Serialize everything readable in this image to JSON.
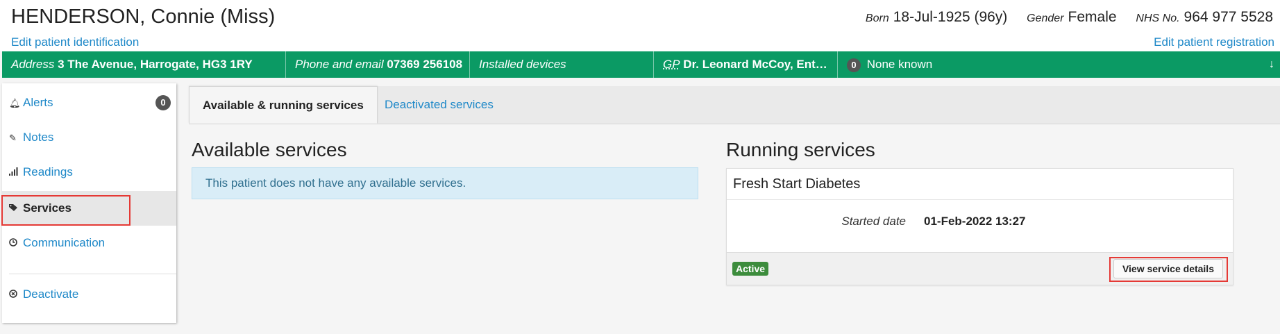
{
  "patient": {
    "name": "HENDERSON, Connie (Miss)",
    "born_label": "Born",
    "born_value": "18-Jul-1925 (96y)",
    "gender_label": "Gender",
    "gender_value": "Female",
    "nhs_label": "NHS No.",
    "nhs_value": "964 977 5528",
    "edit_identification": "Edit patient identification",
    "edit_registration": "Edit patient registration"
  },
  "banner": {
    "address_label": "Address",
    "address_value": "3 The Avenue, Harrogate, HG3 1RY",
    "phone_label": "Phone and email",
    "phone_value": "07369 256108",
    "devices_label": "Installed devices",
    "gp_label": "GP",
    "gp_value": "Dr. Leonard McCoy, Ent…",
    "allergy_count": "0",
    "allergy_text": "None known",
    "expand_icon": "↓",
    "color": "#0b9a64"
  },
  "sidebar": {
    "items": [
      {
        "label": "Alerts",
        "icon": "bell-icon",
        "badge": "0"
      },
      {
        "label": "Notes",
        "icon": "edit-icon"
      },
      {
        "label": "Readings",
        "icon": "signal-icon"
      },
      {
        "label": "Services",
        "icon": "tags-icon",
        "active": true
      },
      {
        "label": "Communication",
        "icon": "clock-icon"
      },
      {
        "label": "Deactivate",
        "icon": "cancel-circle-icon"
      }
    ]
  },
  "tabs": [
    {
      "label": "Available & running services",
      "active": true
    },
    {
      "label": "Deactivated services",
      "active": false
    }
  ],
  "available": {
    "heading": "Available services",
    "message": "This patient does not have any available services."
  },
  "running": {
    "heading": "Running services",
    "service": {
      "name": "Fresh Start Diabetes",
      "started_label": "Started date",
      "started_value": "01-Feb-2022 13:27",
      "status": "Active",
      "view_button": "View service details"
    }
  },
  "colors": {
    "link": "#1e88c8",
    "status_active": "#3c8c3c",
    "highlight": "#e53935"
  }
}
